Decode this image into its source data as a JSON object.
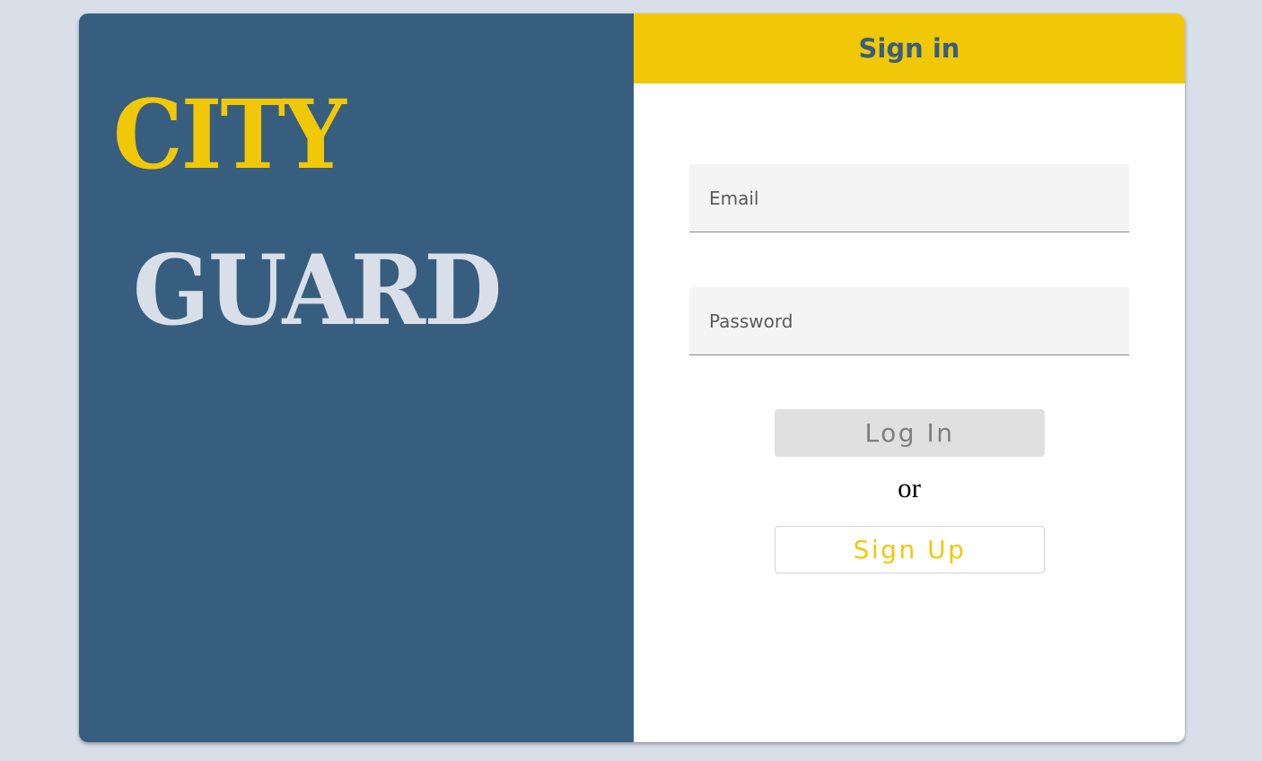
{
  "brand": {
    "word1": "CITY",
    "word2": "GUARD"
  },
  "form": {
    "title": "Sign in",
    "email_placeholder": "Email",
    "password_placeholder": "Password",
    "login_label": "Log In",
    "or_text": "or",
    "signup_label": "Sign Up"
  },
  "colors": {
    "brand_panel": "#385e7f",
    "accent_yellow": "#f0c808",
    "light_gray_blue": "#d9dfe9"
  }
}
